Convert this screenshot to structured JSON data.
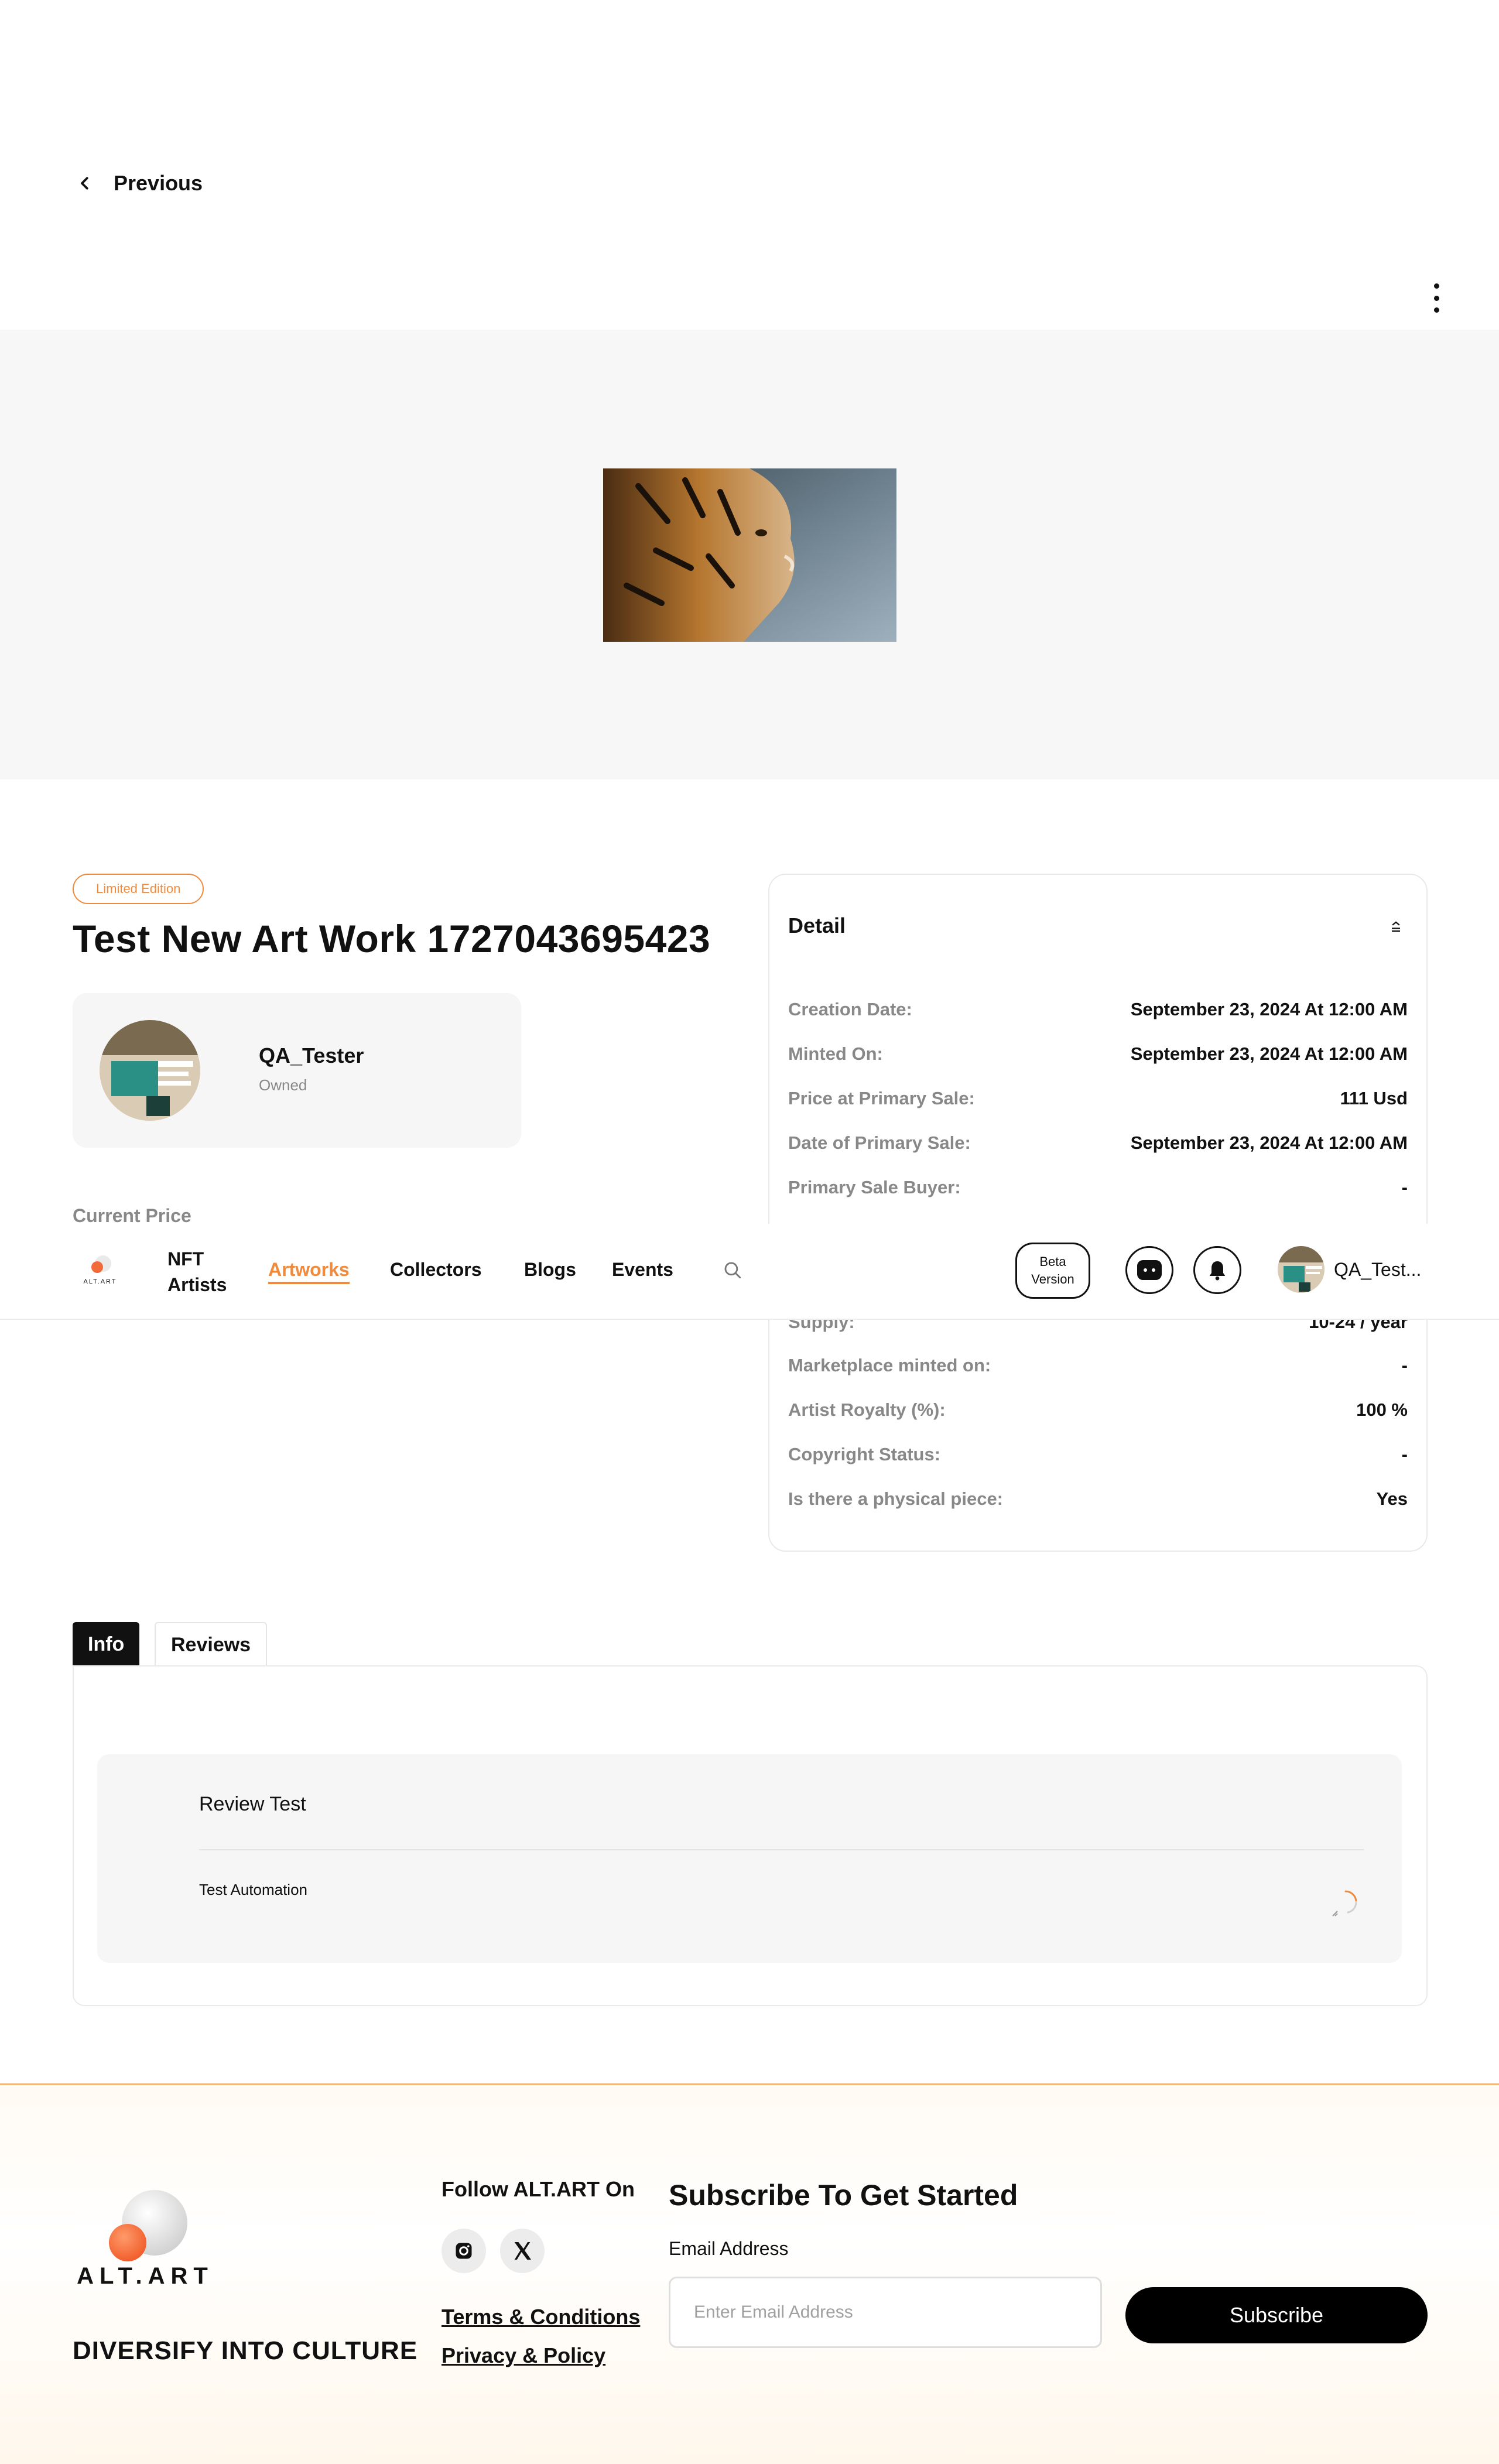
{
  "header": {
    "back_label": "Previous",
    "more_icon": "kebab-icon"
  },
  "artwork": {
    "edition_badge": "Limited Edition",
    "title": "Test New Art Work 1727043695423",
    "owner": {
      "name": "QA_Tester",
      "status": "Owned"
    },
    "current_price_label": "Current Price"
  },
  "detail": {
    "title": "Detail",
    "rows": [
      {
        "label": "Creation Date:",
        "value": "September 23, 2024 At 12:00 AM"
      },
      {
        "label": "Minted On:",
        "value": "September 23, 2024 At 12:00 AM"
      },
      {
        "label": "Price at Primary Sale:",
        "value": "111 Usd"
      },
      {
        "label": "Date of Primary Sale:",
        "value": "September 23, 2024 At 12:00 AM"
      },
      {
        "label": "Primary Sale Buyer:",
        "value": "-"
      },
      {
        "label": "Supply:",
        "value": "10-24 / year"
      },
      {
        "label": "Marketplace minted on:",
        "value": "-"
      },
      {
        "label": "Artist Royalty (%):",
        "value": "100 %"
      },
      {
        "label": "Copyright Status:",
        "value": "-"
      },
      {
        "label": "Is there a physical piece:",
        "value": "Yes"
      }
    ]
  },
  "nav": {
    "logo_text": "ALT.ART",
    "items": [
      "NFT Artists",
      "Artworks",
      "Collectors",
      "Blogs",
      "Events"
    ],
    "nft_line1": "NFT",
    "nft_line2": "Artists",
    "active_item": "Artworks",
    "beta_line1": "Beta",
    "beta_line2": "Version",
    "user_name": "QA_Test..."
  },
  "tabs": {
    "items": [
      "Info",
      "Reviews"
    ],
    "active": "Info"
  },
  "review": {
    "title": "Review Test",
    "body": "Test Automation"
  },
  "footer": {
    "logo_text": "ALT.ART",
    "tagline": "DIVERSIFY INTO CULTURE",
    "follow_label": "Follow ALT.ART On",
    "terms_link": "Terms & Conditions",
    "privacy_link": "Privacy & Policy",
    "subscribe_title": "Subscribe To Get Started",
    "email_label": "Email Address",
    "email_placeholder": "Enter Email Address",
    "email_value": "",
    "subscribe_button": "Subscribe"
  },
  "colors": {
    "accent": "#f08a3c",
    "text": "#111111",
    "muted": "#888888",
    "surface": "#f6f6f6"
  }
}
